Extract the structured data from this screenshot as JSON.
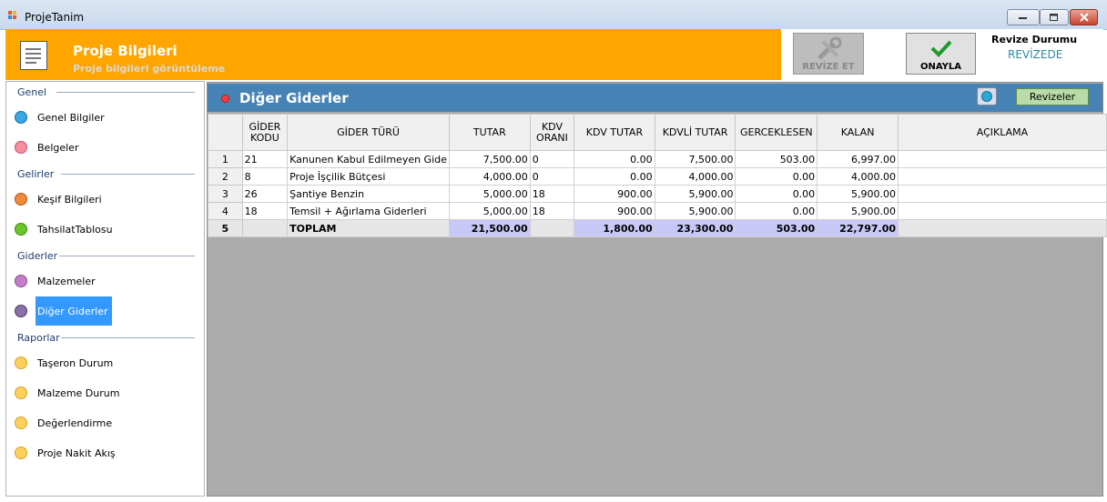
{
  "window": {
    "title": "ProjeTanim"
  },
  "header": {
    "title": "Proje Bilgileri",
    "subtitle": "Proje bilgileri görüntüleme"
  },
  "toolbar": {
    "revize_label": "REVİZE ET",
    "onayla_label": "ONAYLA",
    "revize_durumu_label": "Revize Durumu",
    "revize_durumu_value": "REVİZEDE"
  },
  "sidebar": {
    "sections": [
      {
        "title": "Genel",
        "items": [
          {
            "label": "Genel Bilgiler",
            "color": "#3aa7e4"
          },
          {
            "label": "Belgeler",
            "color": "#f58fa0"
          }
        ]
      },
      {
        "title": "Gelirler",
        "items": [
          {
            "label": "Keşif Bilgileri",
            "color": "#f08a3c"
          },
          {
            "label": "TahsilatTablosu",
            "color": "#6cc62a"
          }
        ]
      },
      {
        "title": "Giderler",
        "items": [
          {
            "label": "Malzemeler",
            "color": "#c77ec9"
          },
          {
            "label": "Diğer Giderler",
            "color": "#8a6fa8",
            "selected": true
          }
        ]
      },
      {
        "title": "Raporlar",
        "items": [
          {
            "label": "Taşeron Durum",
            "color": "#ffd15a"
          },
          {
            "label": "Malzeme Durum",
            "color": "#ffd15a"
          },
          {
            "label": "Değerlendirme",
            "color": "#ffd15a"
          },
          {
            "label": "Proje Nakit Akış",
            "color": "#ffd15a"
          }
        ]
      }
    ]
  },
  "grid": {
    "title": "Diğer Giderler",
    "revizeler_label": "Revizeler",
    "columns": [
      "GİDER KODU",
      "GİDER TÜRÜ",
      "TUTAR",
      "KDV ORANI",
      "KDV TUTAR",
      "KDVLİ TUTAR",
      "GERCEKLESEN",
      "KALAN",
      "AÇIKLAMA"
    ],
    "rows": [
      {
        "n": "1",
        "kod": "21",
        "tur": "Kanunen Kabul Edilmeyen Gide",
        "tutar": "7,500.00",
        "kdv_orani": "0",
        "kdv_tutar": "0.00",
        "kdvli": "7,500.00",
        "gerceklesen": "503.00",
        "kalan": "6,997.00",
        "aciklama": ""
      },
      {
        "n": "2",
        "kod": "8",
        "tur": "Proje İşçilik Bütçesi",
        "tutar": "4,000.00",
        "kdv_orani": "0",
        "kdv_tutar": "0.00",
        "kdvli": "4,000.00",
        "gerceklesen": "0.00",
        "kalan": "4,000.00",
        "aciklama": ""
      },
      {
        "n": "3",
        "kod": "26",
        "tur": "Şantiye Benzin",
        "tutar": "5,000.00",
        "kdv_orani": "18",
        "kdv_tutar": "900.00",
        "kdvli": "5,900.00",
        "gerceklesen": "0.00",
        "kalan": "5,900.00",
        "aciklama": ""
      },
      {
        "n": "4",
        "kod": "18",
        "tur": "Temsil + Ağırlama Giderleri",
        "tutar": "5,000.00",
        "kdv_orani": "18",
        "kdv_tutar": "900.00",
        "kdvli": "5,900.00",
        "gerceklesen": "0.00",
        "kalan": "5,900.00",
        "aciklama": ""
      }
    ],
    "total": {
      "n": "5",
      "label": "TOPLAM",
      "tutar": "21,500.00",
      "kdv_tutar": "1,800.00",
      "kdvli": "23,300.00",
      "gerceklesen": "503.00",
      "kalan": "22,797.00"
    }
  }
}
